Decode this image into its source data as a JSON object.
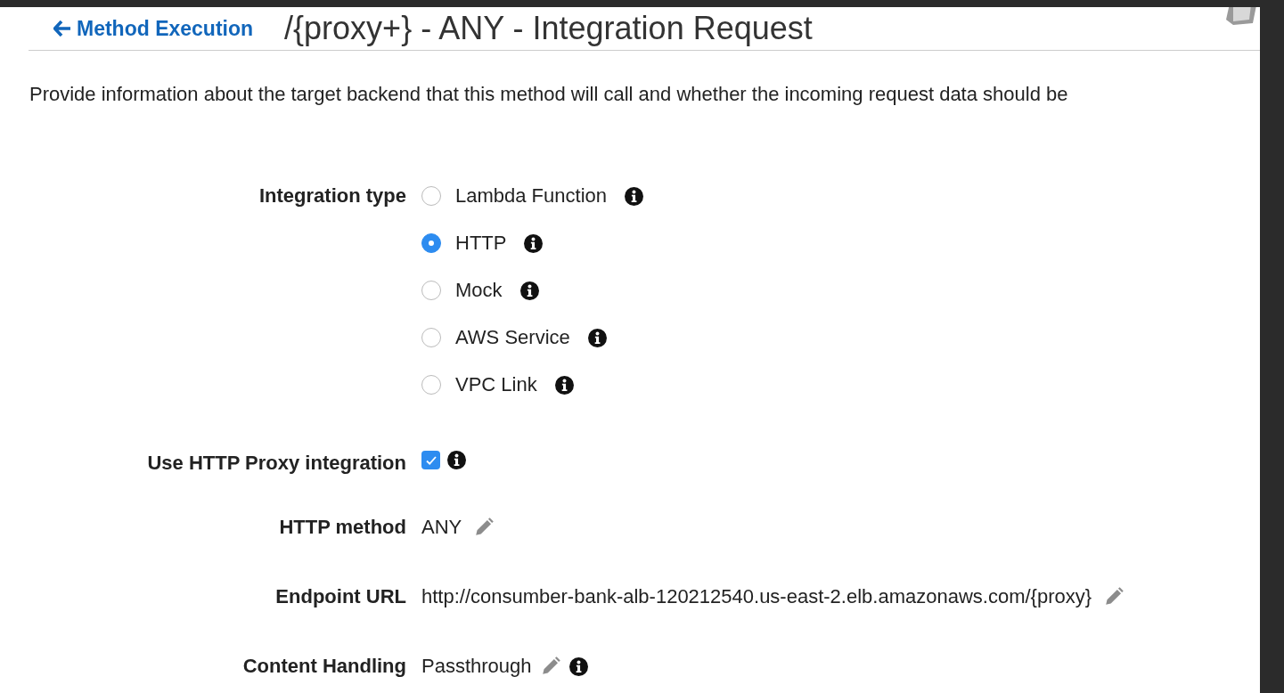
{
  "header": {
    "back_link": "Method Execution",
    "title": "/{proxy+} - ANY - Integration Request"
  },
  "description": "Provide information about the target backend that this method will call and whether the incoming request data should be",
  "fields": [
    {
      "label": "Integration type",
      "kind": "radio",
      "options": [
        {
          "label": "Lambda Function",
          "selected": false
        },
        {
          "label": "HTTP",
          "selected": true
        },
        {
          "label": "Mock",
          "selected": false
        },
        {
          "label": "AWS Service",
          "selected": false
        },
        {
          "label": "VPC Link",
          "selected": false
        }
      ]
    },
    {
      "label": "Use HTTP Proxy integration",
      "kind": "checkbox",
      "checked": true,
      "info": true
    },
    {
      "label": "HTTP method",
      "kind": "text",
      "value": "ANY",
      "editable": true,
      "info": false
    },
    {
      "label": "Endpoint URL",
      "kind": "text",
      "value": "http://consumber-bank-alb-120212540.us-east-2.elb.amazonaws.com/{proxy}",
      "editable": true,
      "info": false
    },
    {
      "label": "Content Handling",
      "kind": "text",
      "value": "Passthrough",
      "editable": true,
      "info": true
    }
  ]
}
